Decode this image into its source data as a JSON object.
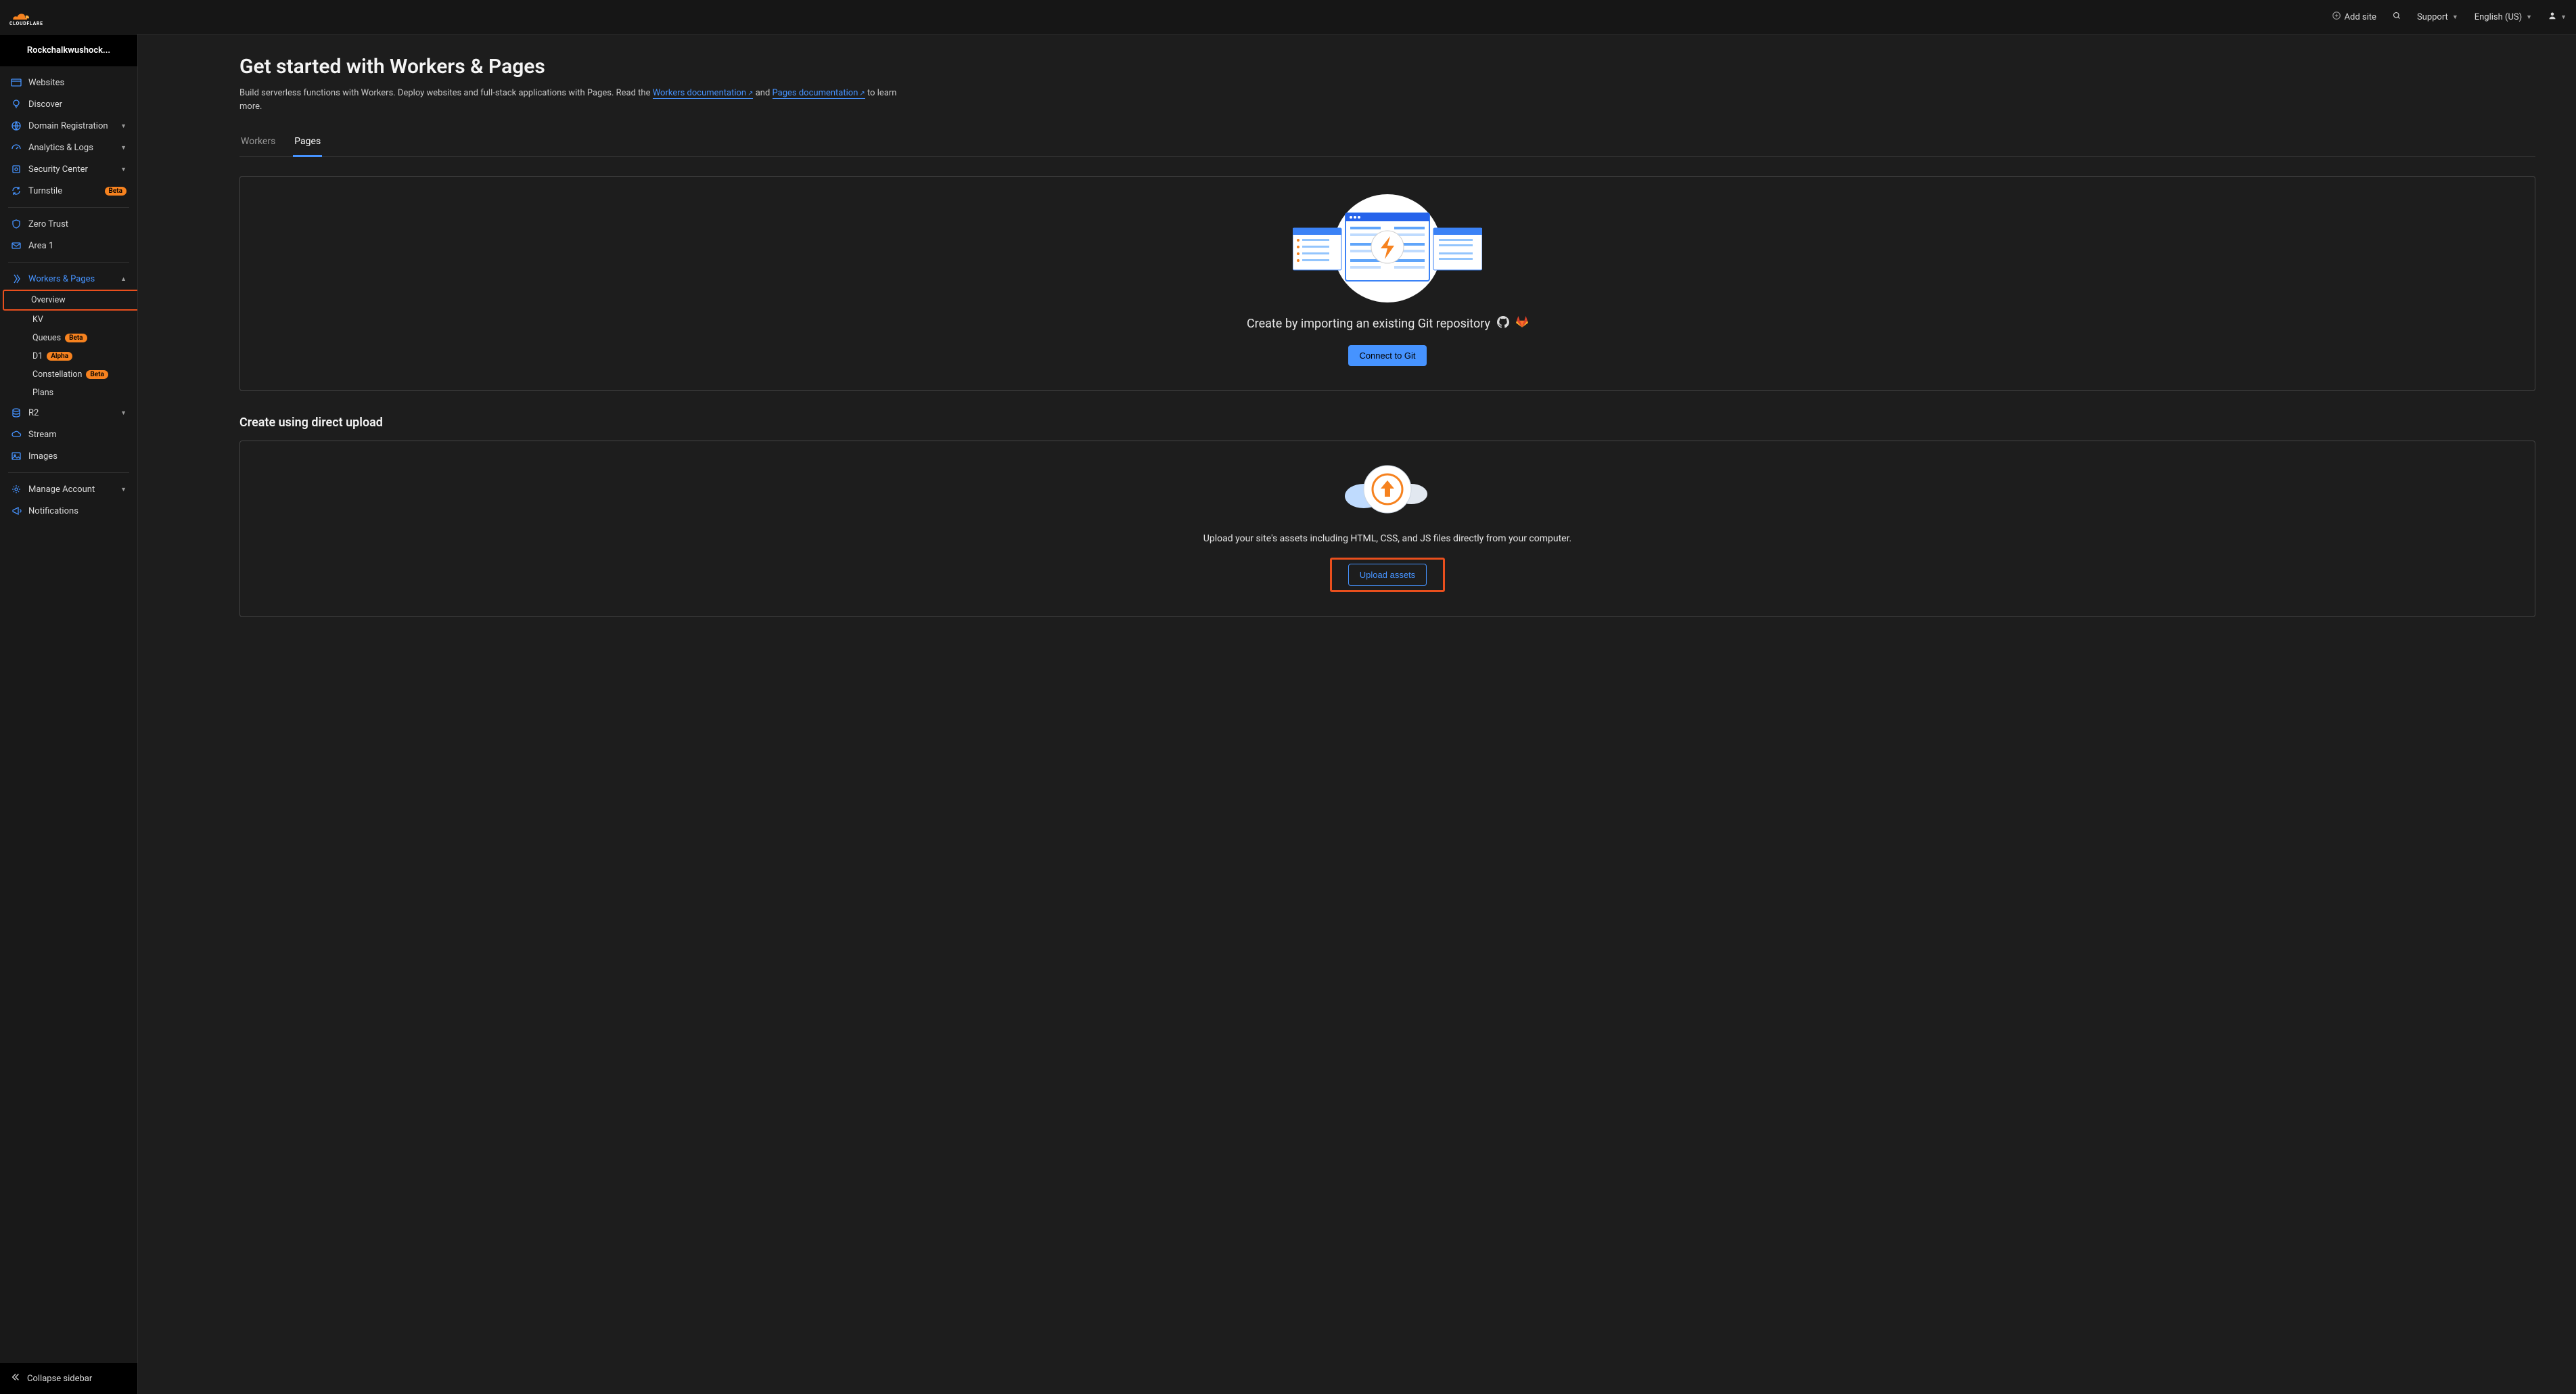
{
  "header": {
    "add_site": "Add site",
    "support": "Support",
    "language": "English (US)"
  },
  "account": {
    "name": "Rockchalkwushock..."
  },
  "sidebar": {
    "items": [
      {
        "label": "Websites"
      },
      {
        "label": "Discover"
      },
      {
        "label": "Domain Registration"
      },
      {
        "label": "Analytics & Logs"
      },
      {
        "label": "Security Center"
      },
      {
        "label": "Turnstile",
        "badge": "Beta"
      },
      {
        "label": "Zero Trust"
      },
      {
        "label": "Area 1"
      },
      {
        "label": "Workers & Pages"
      },
      {
        "label": "R2"
      },
      {
        "label": "Stream"
      },
      {
        "label": "Images"
      },
      {
        "label": "Manage Account"
      },
      {
        "label": "Notifications"
      }
    ],
    "workers_sub": [
      {
        "label": "Overview"
      },
      {
        "label": "KV"
      },
      {
        "label": "Queues",
        "badge": "Beta"
      },
      {
        "label": "D1",
        "badge": "Alpha"
      },
      {
        "label": "Constellation",
        "badge": "Beta"
      },
      {
        "label": "Plans"
      }
    ],
    "collapse": "Collapse sidebar"
  },
  "main": {
    "title": "Get started with Workers & Pages",
    "desc_pre": "Build serverless functions with Workers. Deploy websites and full-stack applications with Pages. Read the ",
    "workers_doc": "Workers documentation",
    "desc_mid": " and ",
    "pages_doc": "Pages documentation",
    "desc_post": " to learn more.",
    "tabs": {
      "workers": "Workers",
      "pages": "Pages"
    },
    "git_panel": {
      "heading": "Create by importing an existing Git repository",
      "button": "Connect to Git"
    },
    "upload_section_title": "Create using direct upload",
    "upload_panel": {
      "text": "Upload your site's assets including HTML, CSS, and JS files directly from your computer.",
      "button": "Upload assets"
    }
  }
}
